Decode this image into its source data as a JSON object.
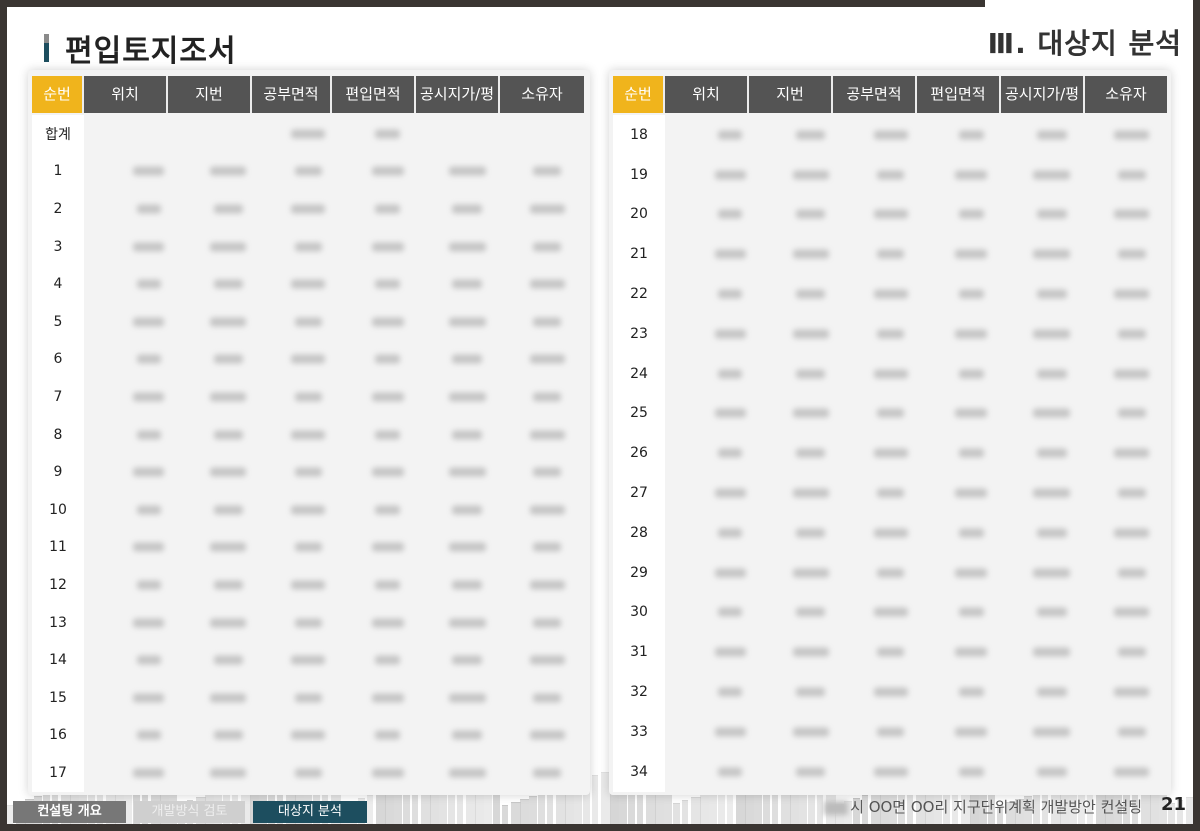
{
  "header": {
    "page_title": "편입토지조서",
    "section_title": "Ⅲ. 대상지 분석"
  },
  "table": {
    "columns": [
      "순번",
      "위치",
      "지번",
      "공부면적",
      "편입면적",
      "공시지가/평",
      "소유자"
    ],
    "left_rows": [
      "합계",
      "1",
      "2",
      "3",
      "4",
      "5",
      "6",
      "7",
      "8",
      "9",
      "10",
      "11",
      "12",
      "13",
      "14",
      "15",
      "16",
      "17"
    ],
    "right_rows": [
      "18",
      "19",
      "20",
      "21",
      "22",
      "23",
      "24",
      "25",
      "26",
      "27",
      "28",
      "29",
      "30",
      "31",
      "32",
      "33",
      "34"
    ]
  },
  "footer": {
    "tabs": [
      "컨설팅 개요",
      "개발방식 검토",
      "대상지 분석"
    ],
    "caption": "시 OO면 OO리 지구단위계획 개발방안 컨설팅",
    "page_number": "21"
  }
}
